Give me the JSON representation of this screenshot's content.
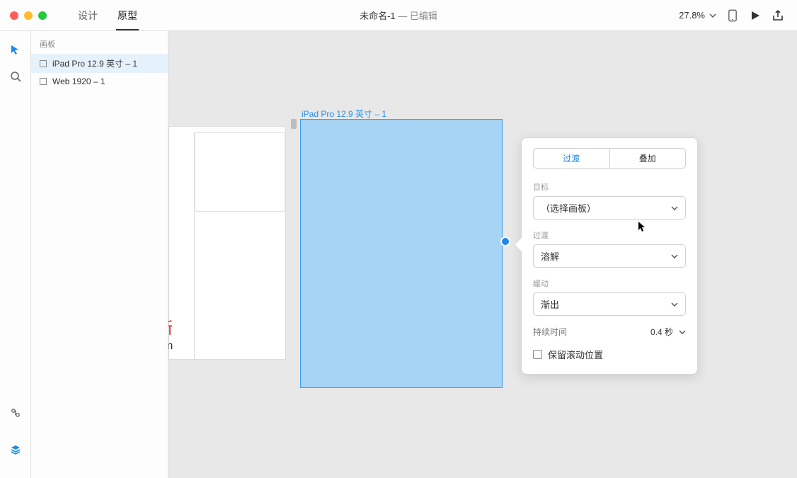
{
  "titlebar": {
    "tabs": {
      "design": "设计",
      "prototype": "原型"
    },
    "docname": "未命名-1",
    "sep": " — ",
    "state": "已编辑",
    "zoom": "27.8%"
  },
  "layers": {
    "section": "画板",
    "items": [
      {
        "label": "iPad Pro 12.9 英寸 – 1"
      },
      {
        "label": "Web 1920 – 1"
      }
    ]
  },
  "canvas": {
    "selected_label": "iPad Pro 12.9 英寸 – 1"
  },
  "watermark": {
    "zh": "拉普拉斯",
    "url": "lapulace.com"
  },
  "popover": {
    "seg": {
      "transition": "过渡",
      "overlay": "叠加"
    },
    "target_label": "目标",
    "target_value": "（选择画板）",
    "transition_label": "过渡",
    "transition_value": "溶解",
    "easing_label": "缓动",
    "easing_value": "渐出",
    "duration_label": "持续时间",
    "duration_value": "0.4 秒",
    "preserve_scroll": "保留滚动位置"
  }
}
